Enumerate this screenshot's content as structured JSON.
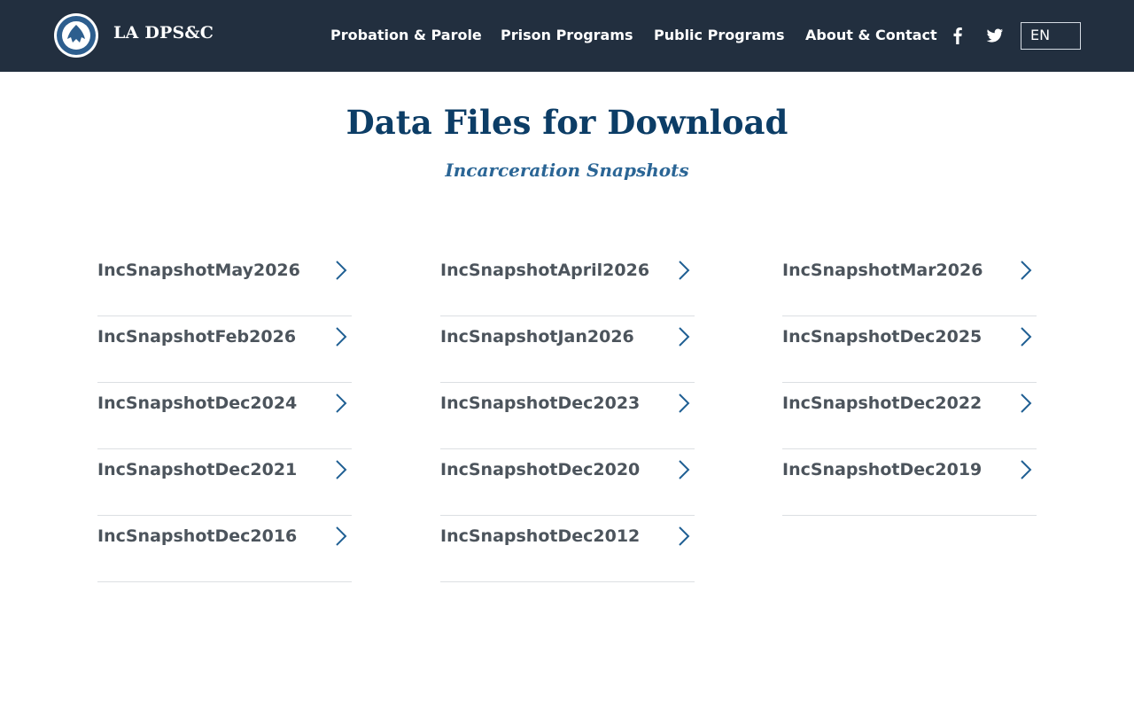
{
  "header": {
    "brand": "LA DPS&C",
    "nav": [
      {
        "label": "Probation & Parole"
      },
      {
        "label": "Prison Programs"
      },
      {
        "label": "Public Programs"
      },
      {
        "label": "About & Contact"
      }
    ],
    "social": [
      "facebook-icon",
      "twitter-icon"
    ],
    "language": "EN"
  },
  "main": {
    "title": "Data Files for Download",
    "subtitle": "Incarceration Snapshots",
    "files": [
      {
        "label": "IncSnapshotMay2026"
      },
      {
        "label": "IncSnapshotApril2026"
      },
      {
        "label": "IncSnapshotMar2026"
      },
      {
        "label": "IncSnapshotFeb2026"
      },
      {
        "label": "IncSnapshotJan2026"
      },
      {
        "label": "IncSnapshotDec2025"
      },
      {
        "label": "IncSnapshotDec2024"
      },
      {
        "label": "IncSnapshotDec2023"
      },
      {
        "label": "IncSnapshotDec2022"
      },
      {
        "label": "IncSnapshotDec2021"
      },
      {
        "label": "IncSnapshotDec2020"
      },
      {
        "label": "IncSnapshotDec2019"
      },
      {
        "label": "IncSnapshotDec2016"
      },
      {
        "label": "IncSnapshotDec2012"
      }
    ]
  },
  "colors": {
    "header_bg": "#222f3f",
    "title": "#0c3d66",
    "subtitle": "#2a6595",
    "link_text": "#4c545c",
    "chevron": "#1f5f93",
    "divider": "#dcdfe3"
  }
}
